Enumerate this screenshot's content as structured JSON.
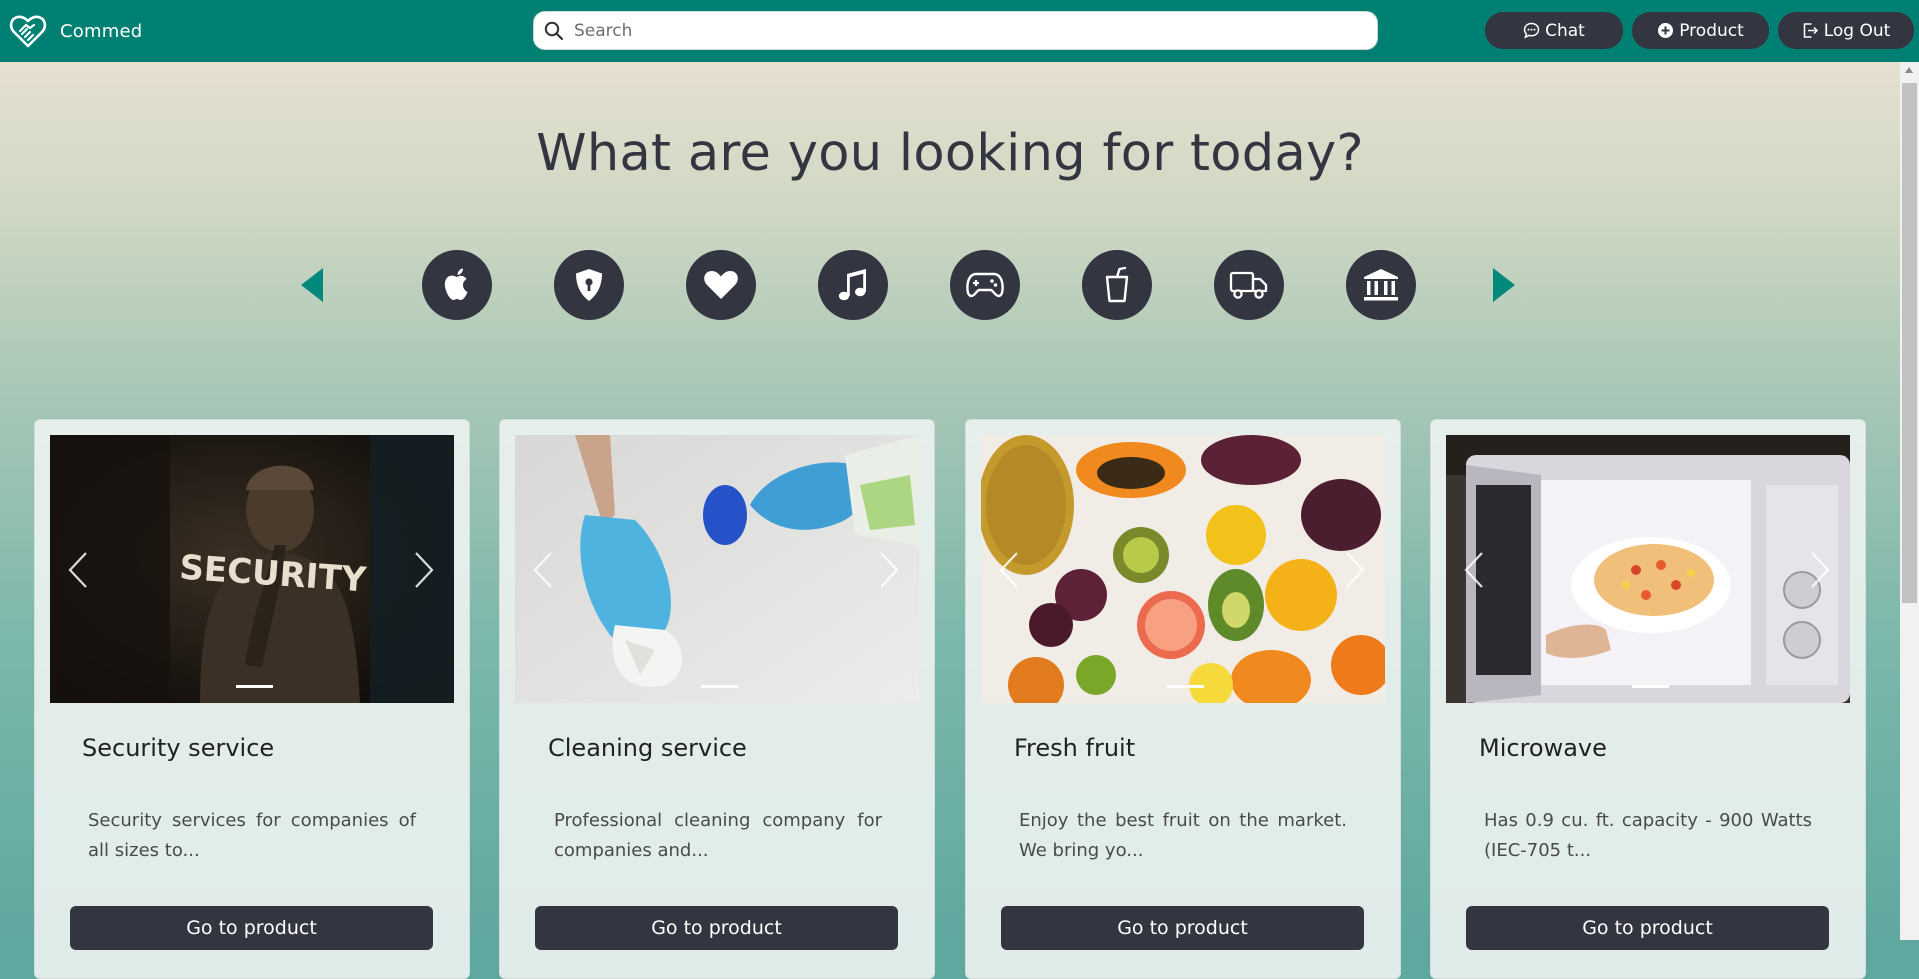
{
  "brand": {
    "name": "Commed",
    "icon": "handshake-heart-icon"
  },
  "search": {
    "placeholder": "Search",
    "value": ""
  },
  "nav": {
    "chat_label": "Chat",
    "product_label": "Product",
    "logout_label": "Log Out"
  },
  "hero": {
    "headline": "What are you looking for today?"
  },
  "categories": [
    {
      "icon": "apple-icon"
    },
    {
      "icon": "shield-lock-icon"
    },
    {
      "icon": "heart-icon"
    },
    {
      "icon": "music-note-icon"
    },
    {
      "icon": "gamepad-icon"
    },
    {
      "icon": "cup-straw-icon"
    },
    {
      "icon": "truck-icon"
    },
    {
      "icon": "bank-icon"
    }
  ],
  "products": [
    {
      "title": "Security service",
      "description": "Security services for companies of all sizes to...",
      "button": "Go to product",
      "image": "security-guard-photo"
    },
    {
      "title": "Cleaning service",
      "description": "Professional cleaning company for companies and...",
      "button": "Go to product",
      "image": "cleaning-gloves-photo"
    },
    {
      "title": "Fresh fruit",
      "description": "Enjoy the best fruit on the market. We bring yo...",
      "button": "Go to product",
      "image": "fresh-fruit-photo"
    },
    {
      "title": "Microwave",
      "description": "Has 0.9 cu. ft. capacity - 900 Watts (IEC-705 t...",
      "button": "Go to product",
      "image": "microwave-pizza-photo"
    }
  ],
  "colors": {
    "navbar": "#007f73",
    "dark": "#333640",
    "teal_arrow": "#00897b"
  }
}
